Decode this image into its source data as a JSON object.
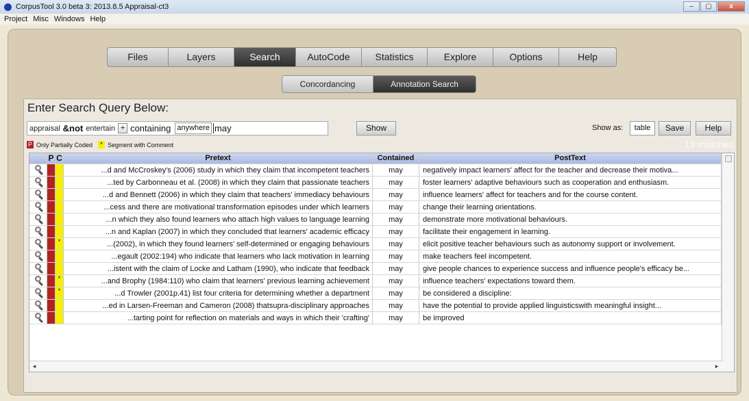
{
  "window": {
    "title": "CorpusTool 3.0 beta 3: 2013.8.5 Appraisal-ct3",
    "minimize": "–",
    "maximize": "▢",
    "close": "x"
  },
  "menu": [
    "Project",
    "Misc",
    "Windows",
    "Help"
  ],
  "tabs": [
    {
      "label": "Files"
    },
    {
      "label": "Layers"
    },
    {
      "label": "Search"
    },
    {
      "label": "AutoCode"
    },
    {
      "label": "Statistics"
    },
    {
      "label": "Explore"
    },
    {
      "label": "Options"
    },
    {
      "label": "Help"
    }
  ],
  "subtabs": {
    "concordancing": "Concordancing",
    "annotation_search": "Annotation Search"
  },
  "query": {
    "heading": "Enter Search Query Below:",
    "term1": "appraisal",
    "operator": "&not",
    "term2": "entertain",
    "plus": "+",
    "containing": "containing",
    "scope": "anywhere",
    "value": "may",
    "show_button": "Show"
  },
  "output": {
    "show_as_label": "Show as:",
    "show_as_value": "table",
    "save_button": "Save",
    "help_button": "Help"
  },
  "legend": {
    "partial_marker": "P",
    "partial_label": "Only Partially Coded",
    "comment_marker": "*",
    "comment_label": "Segment with Comment",
    "matches": "13 matches"
  },
  "table": {
    "headers": {
      "p": "P",
      "c": "C",
      "pretext": "Pretext",
      "contained": "Contained",
      "posttext": "PostText"
    },
    "rows": [
      {
        "c": "",
        "pre": "...d and McCroskey's (2006) study in which they claim that incompetent teachers",
        "con": "may",
        "post": "negatively impact learners' affect for the teacher and decrease their motiva..."
      },
      {
        "c": "",
        "pre": "...ted by Carbonneau et al. (2008) in which they claim that passionate teachers",
        "con": "may",
        "post": "foster learners' adaptive behaviours such as cooperation and enthusiasm."
      },
      {
        "c": "",
        "pre": "...d and Bennett (2006) in which they claim that teachers' immediacy behaviours",
        "con": "may",
        "post": "influence learners' affect for teachers and for the course content."
      },
      {
        "c": "",
        "pre": "...cess and there are motivational transformation episodes under which learners",
        "con": "may",
        "post": "change their learning orientations."
      },
      {
        "c": "",
        "pre": "...n which they also found learners who attach high values to language learning",
        "con": "may",
        "post": "demonstrate more motivational behaviours."
      },
      {
        "c": "",
        "pre": "...n and Kaplan (2007) in which they concluded that learners' academic efficacy",
        "con": "may",
        "post": "facilitate their engagement in learning."
      },
      {
        "c": "*",
        "pre": "...(2002), in which they found learners' self-determined or engaging behaviours",
        "con": "may",
        "post": "elicit positive teacher behaviours such as autonomy support or involvement."
      },
      {
        "c": "",
        "pre": "...egault (2002:194) who indicate that learners who lack motivation in learning",
        "con": "may",
        "post": "make teachers feel incompetent."
      },
      {
        "c": "",
        "pre": "...istent with the claim of Locke and Latham (1990), who indicate that feedback",
        "con": "may",
        "post": "give people chances to experience success and influence people's efficacy be..."
      },
      {
        "c": "*",
        "pre": "...and Brophy (1984:110) who claim that learners' previous learning achievement",
        "con": "may",
        "post": "influence teachers' expectations toward them."
      },
      {
        "c": "*",
        "pre": "...d Trowler (2001p.41) list four criteria for determining whether a department",
        "con": "may",
        "post": "be considered a discipline:"
      },
      {
        "c": "",
        "pre": "...ed in Larsen-Freeman and Cameron (2008) thatsupra-disciplinary  approaches",
        "con": "may",
        "post": " have  the potential to provide applied linguisticswith meaningful insight..."
      },
      {
        "c": "",
        "pre": "...tarting point for reflection on materials and ways in which their 'crafting'",
        "con": "may",
        "post": "be improved"
      }
    ]
  },
  "colors": {
    "partial": "#b02323",
    "comment": "#f4f000",
    "header": "#b4c0e6",
    "active_tab": "#3c3c3c"
  }
}
